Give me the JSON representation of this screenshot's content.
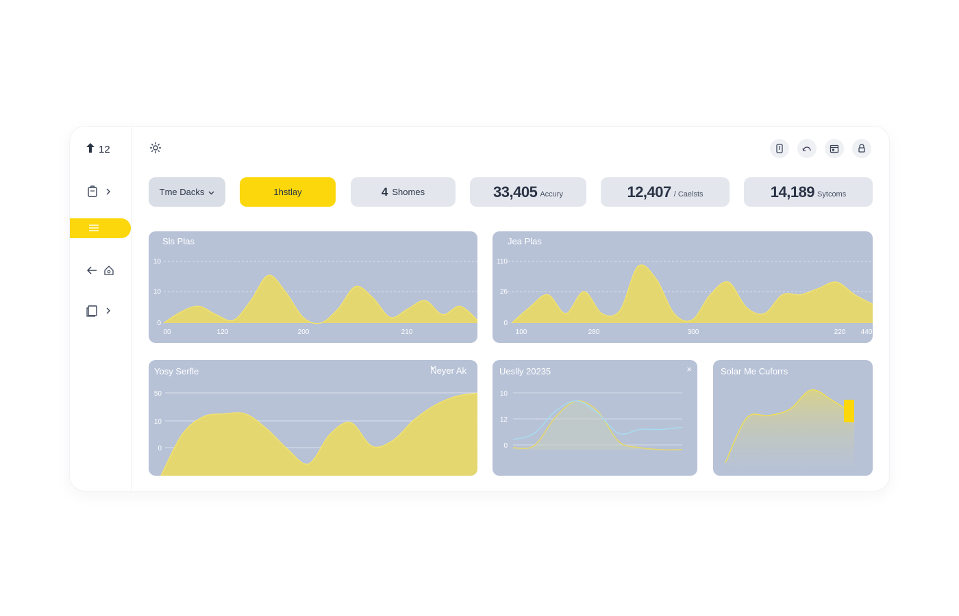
{
  "sidebar": {
    "top_label": "12",
    "items": [
      {
        "icon": "clipboard-icon",
        "chevron": "chevron-right-icon"
      },
      {
        "icon": "menu-icon",
        "active": true
      },
      {
        "icon": "back-arrow-icon",
        "secondary_icon": "home-icon"
      },
      {
        "icon": "document-icon",
        "chevron": "chevron-right-icon"
      }
    ]
  },
  "header": {
    "icon": "gear-icon",
    "right_icons": [
      "phone-icon",
      "refresh-icon",
      "calendar-icon",
      "lock-icon"
    ]
  },
  "filters": {
    "dropdown_label": "Tme Dacks",
    "active_label": "1hstlay",
    "shares_number": "4",
    "shares_label": "Shomes"
  },
  "stats": [
    {
      "value": "33,405",
      "label": "Accury"
    },
    {
      "value": "12,407",
      "label": "/ Caelsts"
    },
    {
      "value": "14,189",
      "label": "Sytcoms"
    }
  ],
  "colors": {
    "accent": "#fbd70c",
    "card_bg": "#b7c2d7",
    "area_fill": "#e7d86a",
    "line_blue": "#a8dcf0"
  },
  "cards": {
    "top_left": {
      "title": "Sls Plas",
      "y_ticks": [
        "10",
        "10",
        "0"
      ],
      "x_ticks": [
        "00",
        "120",
        "200",
        "210"
      ]
    },
    "top_right": {
      "title": "Jea Plas",
      "y_ticks": [
        "110",
        "26",
        "0"
      ],
      "x_ticks": [
        "100",
        "280",
        "300",
        "220",
        "440"
      ]
    },
    "bottom_left": {
      "title": "Yosy Serfle",
      "selector": "Neyer Ak",
      "y_ticks": [
        "50",
        "10",
        "0"
      ]
    },
    "bottom_mid": {
      "title": "Ueslly 20235",
      "close": "×",
      "y_ticks": [
        "10",
        "12",
        "0"
      ]
    },
    "bottom_right": {
      "title": "Solar Me Cuforrs"
    }
  },
  "chart_data": [
    {
      "type": "area",
      "title": "Sls Plas",
      "x": [
        0,
        25,
        50,
        75,
        100,
        125,
        150,
        175,
        200,
        225,
        250,
        275,
        300,
        325,
        350,
        375,
        400,
        425,
        450
      ],
      "y": [
        0,
        4,
        6,
        3,
        1,
        8,
        17,
        11,
        2,
        0,
        5,
        13,
        9,
        2,
        5,
        8,
        3,
        6,
        1
      ],
      "tick_labels_x": [
        "00",
        "120",
        "200",
        "210"
      ],
      "tick_labels_y": [
        "10",
        "10",
        "0"
      ]
    },
    {
      "type": "area",
      "title": "Jea Plas",
      "x": [
        0,
        25,
        50,
        75,
        100,
        125,
        150,
        175,
        200,
        225,
        250,
        275,
        300,
        325,
        350,
        375,
        400,
        425,
        450,
        475,
        500
      ],
      "y": [
        0,
        5,
        9,
        3,
        10,
        3,
        4,
        18,
        14,
        3,
        1,
        9,
        13,
        5,
        3,
        9,
        9,
        11,
        13,
        9,
        6
      ],
      "tick_labels_x": [
        "100",
        "280",
        "300",
        "220",
        "440"
      ],
      "tick_labels_y": [
        "110",
        "26",
        "0"
      ]
    },
    {
      "type": "area",
      "title": "Yosy Serfle",
      "x": [
        0,
        30,
        60,
        90,
        120,
        150,
        180,
        210,
        240,
        270,
        300,
        330,
        360,
        390,
        420,
        450
      ],
      "y": [
        0,
        14,
        20,
        21,
        21,
        16,
        9,
        4,
        14,
        18,
        10,
        12,
        19,
        24,
        27,
        28
      ],
      "tick_labels_y": [
        "50",
        "10",
        "0"
      ]
    },
    {
      "type": "line",
      "title": "Ueslly 20235",
      "x": [
        0,
        30,
        60,
        90,
        120,
        150,
        180,
        210,
        240
      ],
      "series": [
        {
          "color": "#e7d86a",
          "values": [
            1,
            2,
            16,
            24,
            19,
            4,
            1,
            0,
            0
          ]
        },
        {
          "color": "#a8dcf0",
          "values": [
            5,
            8,
            19,
            24,
            18,
            8,
            10,
            10,
            11
          ]
        }
      ],
      "tick_labels_y": [
        "10",
        "12",
        "0"
      ]
    },
    {
      "type": "area",
      "title": "Solar Me Cuforrs",
      "x": [
        0,
        30,
        60,
        90,
        120,
        150,
        180
      ],
      "y": [
        0,
        42,
        44,
        50,
        68,
        58,
        45
      ]
    }
  ]
}
